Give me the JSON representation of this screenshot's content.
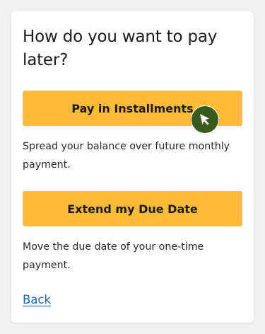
{
  "prompt": {
    "title": "How do you want to pay later?"
  },
  "options": [
    {
      "label": "Pay in Installments",
      "description": "Spread your balance over future monthly payment."
    },
    {
      "label": "Extend my Due Date",
      "description": "Move the due date of your one-time payment."
    }
  ],
  "footer": {
    "back_label": "Back"
  },
  "colors": {
    "accent": "#fbbb37",
    "link": "#1f6aa3",
    "cursor_badge": "#3b5a1e",
    "background": "#f1f1f2"
  },
  "icons": {
    "cursor": "pointer-cursor-icon"
  }
}
